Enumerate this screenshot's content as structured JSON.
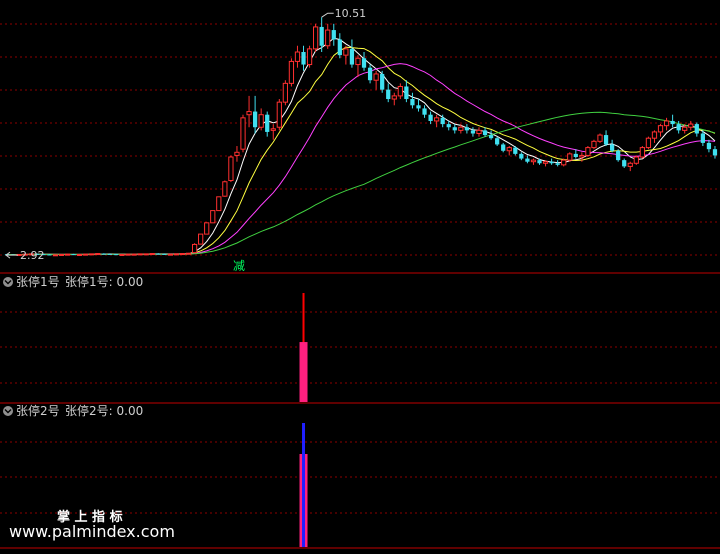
{
  "colors": {
    "background": "#000000",
    "grid": "#8b0000",
    "divider": "#c00000",
    "up": "#ff3030",
    "down": "#40e0f0",
    "ma_short": "#ffffff",
    "ma_mid": "#ffff40",
    "ma_long": "#ff40ff",
    "ma_longest": "#40d040",
    "label": "#d0d0d0",
    "signal_green": "#00ff60",
    "stat_red": "#ff0000",
    "stat_pink": "#ff2080",
    "stat_blue": "#2020ff",
    "watermark": "#ffffff"
  },
  "main": {
    "high_label": "10.51",
    "low_label": "2.92",
    "signal_text": "减"
  },
  "panel1": {
    "title": "张停1号",
    "value_label": "张停1号: 0.00"
  },
  "panel2": {
    "title": "张停2号",
    "value_label": "张停2号: 0.00"
  },
  "watermark": {
    "cn": "掌 上 指 标",
    "url": "www.palmindex.com"
  },
  "chart_data": {
    "type": "candlestick",
    "ylim": [
      2.7,
      10.9
    ],
    "candles": [
      [
        2.95,
        2.96,
        2.93,
        2.94
      ],
      [
        2.94,
        2.95,
        2.92,
        2.93
      ],
      [
        2.93,
        2.95,
        2.92,
        2.94
      ],
      [
        2.94,
        2.96,
        2.93,
        2.95
      ],
      [
        2.95,
        2.97,
        2.94,
        2.96
      ],
      [
        2.96,
        2.97,
        2.94,
        2.95
      ],
      [
        2.95,
        2.96,
        2.93,
        2.94
      ],
      [
        2.94,
        2.95,
        2.92,
        2.93
      ],
      [
        2.93,
        2.94,
        2.92,
        2.93
      ],
      [
        2.93,
        2.95,
        2.92,
        2.94
      ],
      [
        2.94,
        2.96,
        2.93,
        2.95
      ],
      [
        2.95,
        2.96,
        2.93,
        2.94
      ],
      [
        2.94,
        2.95,
        2.93,
        2.94
      ],
      [
        2.94,
        2.96,
        2.93,
        2.95
      ],
      [
        2.95,
        2.97,
        2.94,
        2.96
      ],
      [
        2.96,
        2.98,
        2.95,
        2.97
      ],
      [
        2.97,
        2.98,
        2.95,
        2.96
      ],
      [
        2.96,
        2.97,
        2.94,
        2.95
      ],
      [
        2.95,
        2.96,
        2.93,
        2.94
      ],
      [
        2.94,
        2.95,
        2.93,
        2.94
      ],
      [
        2.94,
        2.96,
        2.93,
        2.95
      ],
      [
        2.95,
        2.96,
        2.94,
        2.95
      ],
      [
        2.95,
        2.97,
        2.94,
        2.96
      ],
      [
        2.96,
        2.97,
        2.95,
        2.96
      ],
      [
        2.96,
        2.98,
        2.95,
        2.97
      ],
      [
        2.97,
        2.98,
        2.95,
        2.96
      ],
      [
        2.96,
        2.97,
        2.94,
        2.95
      ],
      [
        2.95,
        2.96,
        2.94,
        2.95
      ],
      [
        2.95,
        2.97,
        2.94,
        2.96
      ],
      [
        2.96,
        2.98,
        2.95,
        2.97
      ],
      [
        2.97,
        2.99,
        2.96,
        2.98
      ],
      [
        3.0,
        3.3,
        2.98,
        3.26
      ],
      [
        3.27,
        3.59,
        3.27,
        3.59
      ],
      [
        3.59,
        3.95,
        3.59,
        3.95
      ],
      [
        3.95,
        4.34,
        3.95,
        4.34
      ],
      [
        4.34,
        4.78,
        4.34,
        4.78
      ],
      [
        4.8,
        5.3,
        4.78,
        5.26
      ],
      [
        5.3,
        6.1,
        5.25,
        6.05
      ],
      [
        6.1,
        6.4,
        5.9,
        6.2
      ],
      [
        6.3,
        7.4,
        6.2,
        7.3
      ],
      [
        7.4,
        8.0,
        7.0,
        7.5
      ],
      [
        7.5,
        8.0,
        6.8,
        7.0
      ],
      [
        7.0,
        7.6,
        6.9,
        7.4
      ],
      [
        7.4,
        7.5,
        6.7,
        6.85
      ],
      [
        6.9,
        7.1,
        6.6,
        6.95
      ],
      [
        7.0,
        7.9,
        6.9,
        7.8
      ],
      [
        7.8,
        8.5,
        7.7,
        8.4
      ],
      [
        8.4,
        9.2,
        8.3,
        9.1
      ],
      [
        9.1,
        9.6,
        8.9,
        9.4
      ],
      [
        9.4,
        9.6,
        8.8,
        9.0
      ],
      [
        9.0,
        9.6,
        8.9,
        9.5
      ],
      [
        9.5,
        10.3,
        9.4,
        10.2
      ],
      [
        10.2,
        10.51,
        9.4,
        9.6
      ],
      [
        9.6,
        10.3,
        9.5,
        10.1
      ],
      [
        10.1,
        10.3,
        9.6,
        9.8
      ],
      [
        9.8,
        10.0,
        9.2,
        9.3
      ],
      [
        9.3,
        9.6,
        9.0,
        9.5
      ],
      [
        9.5,
        9.8,
        8.9,
        9.0
      ],
      [
        9.0,
        9.3,
        8.6,
        9.2
      ],
      [
        9.2,
        9.4,
        8.8,
        8.9
      ],
      [
        8.9,
        9.0,
        8.4,
        8.5
      ],
      [
        8.5,
        8.8,
        8.2,
        8.7
      ],
      [
        8.7,
        8.8,
        8.1,
        8.2
      ],
      [
        8.2,
        8.4,
        7.8,
        7.9
      ],
      [
        7.9,
        8.1,
        7.7,
        8.0
      ],
      [
        8.0,
        8.4,
        7.9,
        8.3
      ],
      [
        8.3,
        8.5,
        7.8,
        7.9
      ],
      [
        7.9,
        8.1,
        7.6,
        7.7
      ],
      [
        7.7,
        7.9,
        7.5,
        7.6
      ],
      [
        7.6,
        7.7,
        7.3,
        7.4
      ],
      [
        7.4,
        7.5,
        7.1,
        7.2
      ],
      [
        7.2,
        7.4,
        7.0,
        7.3
      ],
      [
        7.3,
        7.4,
        7.0,
        7.1
      ],
      [
        7.1,
        7.2,
        6.9,
        7.0
      ],
      [
        7.0,
        7.1,
        6.8,
        6.9
      ],
      [
        6.9,
        7.1,
        6.8,
        7.0
      ],
      [
        7.0,
        7.1,
        6.8,
        6.9
      ],
      [
        6.9,
        7.0,
        6.7,
        6.8
      ],
      [
        6.8,
        7.0,
        6.7,
        6.9
      ],
      [
        6.9,
        7.0,
        6.7,
        6.75
      ],
      [
        6.75,
        6.9,
        6.6,
        6.65
      ],
      [
        6.65,
        6.7,
        6.4,
        6.45
      ],
      [
        6.45,
        6.5,
        6.2,
        6.25
      ],
      [
        6.25,
        6.4,
        6.1,
        6.35
      ],
      [
        6.35,
        6.4,
        6.1,
        6.15
      ],
      [
        6.15,
        6.2,
        5.95,
        6.0
      ],
      [
        6.0,
        6.1,
        5.85,
        5.9
      ],
      [
        5.9,
        6.0,
        5.8,
        5.95
      ],
      [
        5.95,
        6.0,
        5.8,
        5.85
      ],
      [
        5.85,
        5.95,
        5.75,
        5.9
      ],
      [
        5.9,
        6.0,
        5.8,
        5.85
      ],
      [
        5.85,
        5.95,
        5.75,
        5.8
      ],
      [
        5.8,
        6.0,
        5.75,
        5.95
      ],
      [
        5.95,
        6.2,
        5.9,
        6.15
      ],
      [
        6.15,
        6.3,
        6.0,
        6.05
      ],
      [
        6.05,
        6.2,
        5.9,
        6.1
      ],
      [
        6.1,
        6.4,
        6.05,
        6.35
      ],
      [
        6.35,
        6.6,
        6.3,
        6.55
      ],
      [
        6.55,
        6.8,
        6.5,
        6.75
      ],
      [
        6.75,
        6.9,
        6.4,
        6.45
      ],
      [
        6.45,
        6.6,
        6.2,
        6.25
      ],
      [
        6.25,
        6.3,
        5.9,
        5.95
      ],
      [
        5.95,
        6.0,
        5.7,
        5.75
      ],
      [
        5.75,
        5.9,
        5.6,
        5.85
      ],
      [
        5.85,
        6.1,
        5.8,
        6.05
      ],
      [
        6.05,
        6.4,
        6.0,
        6.35
      ],
      [
        6.35,
        6.7,
        6.3,
        6.65
      ],
      [
        6.65,
        6.9,
        6.5,
        6.85
      ],
      [
        6.85,
        7.1,
        6.7,
        7.05
      ],
      [
        7.05,
        7.3,
        6.9,
        7.2
      ],
      [
        7.2,
        7.4,
        7.0,
        7.1
      ],
      [
        7.1,
        7.2,
        6.8,
        6.9
      ],
      [
        6.9,
        7.1,
        6.8,
        7.0
      ],
      [
        7.0,
        7.2,
        6.9,
        7.1
      ],
      [
        7.1,
        7.15,
        6.7,
        6.8
      ],
      [
        6.8,
        6.9,
        6.4,
        6.5
      ],
      [
        6.5,
        6.6,
        6.2,
        6.3
      ],
      [
        6.3,
        6.4,
        6.0,
        6.1
      ]
    ],
    "panel1_signal": {
      "bar_index": 49,
      "red_value": 1.0,
      "pink_value": 0.55
    },
    "panel2_signal": {
      "bar_index": 49,
      "blue_value": 1.0,
      "pink_value": 0.75
    }
  }
}
